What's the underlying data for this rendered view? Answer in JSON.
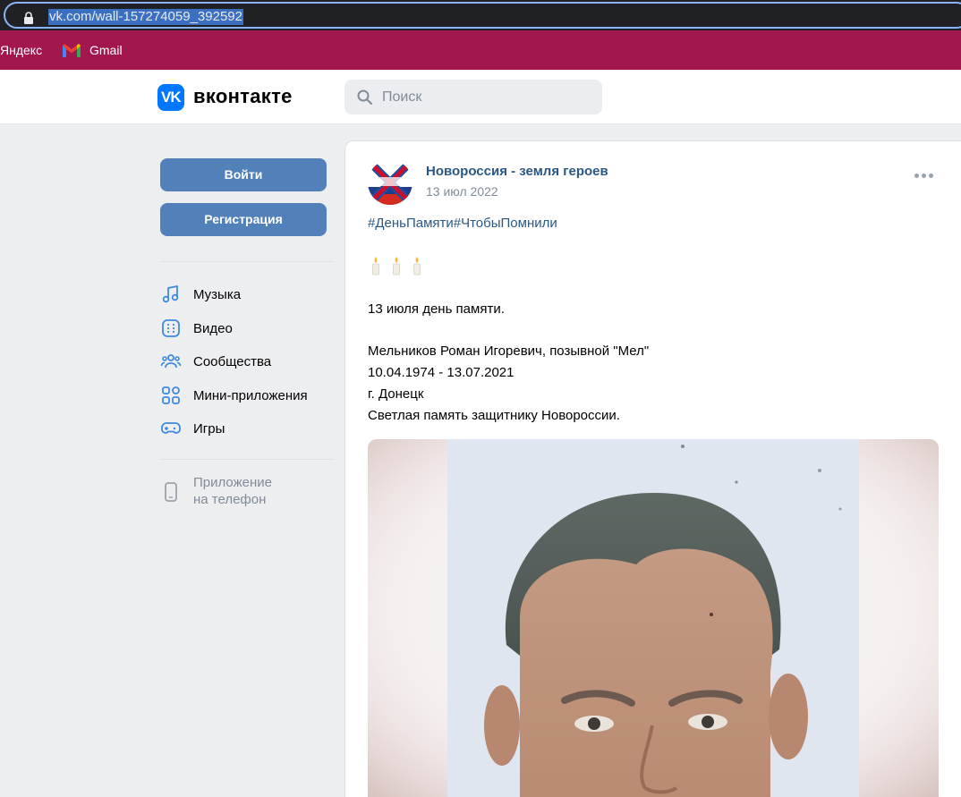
{
  "browser": {
    "url": "vk.com/wall-157274059_392592",
    "bookmarks": [
      "Яндекс",
      "Gmail"
    ]
  },
  "header": {
    "logo_letters": "VK",
    "wordmark": "вконтакте",
    "search_placeholder": "Поиск"
  },
  "sidebar": {
    "login_label": "Войти",
    "register_label": "Регистрация",
    "items": [
      {
        "label": "Музыка",
        "icon": "music-icon"
      },
      {
        "label": "Видео",
        "icon": "video-icon"
      },
      {
        "label": "Сообщества",
        "icon": "communities-icon"
      },
      {
        "label": "Мини-приложения",
        "icon": "mini-apps-icon"
      },
      {
        "label": "Игры",
        "icon": "games-icon"
      }
    ],
    "app_label": "Приложение\nна телефон",
    "app_icon": "phone-icon"
  },
  "post": {
    "author": "Новороссия - земля героев",
    "date": "13 июл 2022",
    "hashtags": "#ДеньПамяти#ЧтобыПомнили",
    "candles_icon": "candle-icon",
    "paragraphs": [
      "13 июля день памяти.",
      "Мельников Роман Игоревич, позывной \"Мел\"",
      "10.04.1974 - 13.07.2021",
      "г. Донецк",
      "Светлая память защитнику Новороссии."
    ],
    "photo_icon": "portrait-photo"
  },
  "colors": {
    "bookmarks_bar": "#a3174f",
    "vk_blue": "#0077ff",
    "button": "#5181b8",
    "link": "#2a5885"
  }
}
